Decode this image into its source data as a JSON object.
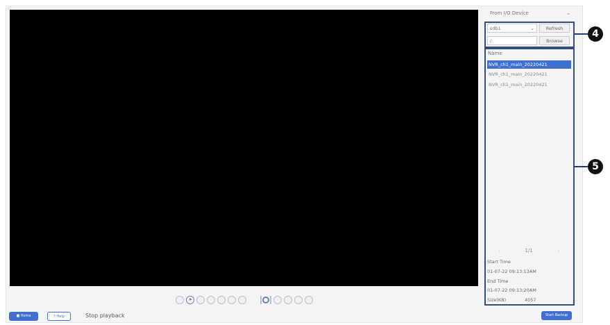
{
  "source": {
    "selected": "From I/O Device",
    "chevron": "chevron-down-icon"
  },
  "device": {
    "selected": "sdb1",
    "refresh_label": "Refresh",
    "path_value": "/",
    "browse_label": "Browse"
  },
  "file_list": {
    "header": "Name",
    "items": [
      "NVR_ch1_main_20220421",
      "NVR_ch1_main_20220421",
      "NVR_ch1_main_20220421"
    ],
    "selected_index": 0
  },
  "pager": {
    "page": "1/1",
    "prev_icon": "chevron-left-icon",
    "next_icon": "chevron-right-icon"
  },
  "details": {
    "start_label": "Start Time",
    "start_value": "01-07-22 09:13:13AM",
    "end_label": "End Time",
    "end_value": "01-07-22 09:13:20AM",
    "size_label": "Size(KB)",
    "size_value": "4057"
  },
  "bottom": {
    "home_label": "Home",
    "help_label": "Help",
    "status": "Stop playback",
    "start_label": "Start Backup"
  },
  "callouts": {
    "box4": "4",
    "box5": "5"
  },
  "colors": {
    "accent": "#3f6fd1",
    "highlight": "#2f4f7f",
    "video": "#000000"
  }
}
